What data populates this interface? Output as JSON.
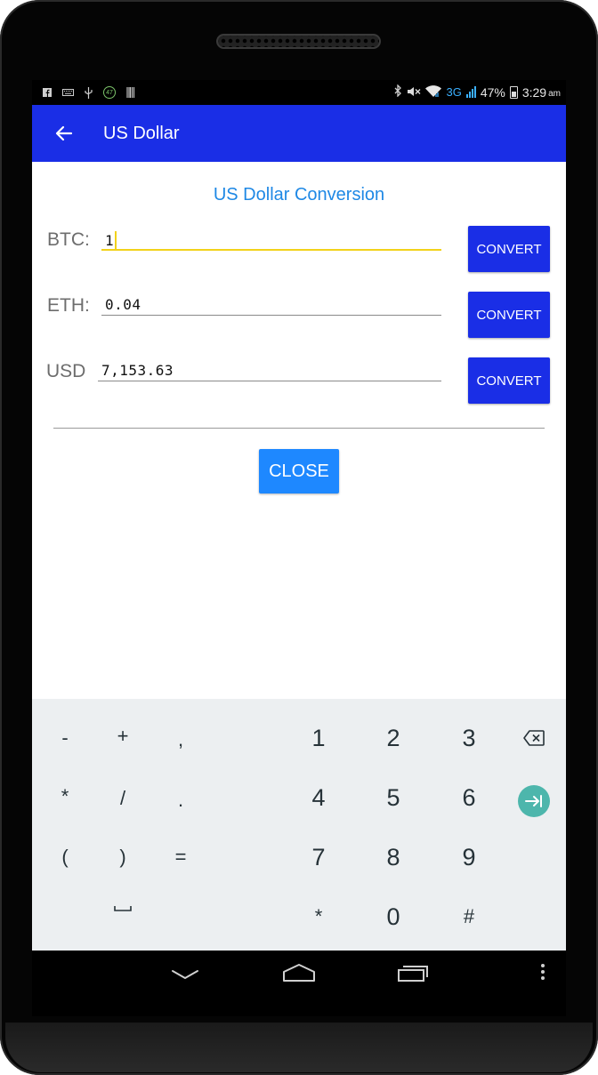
{
  "status_bar": {
    "left_icons": [
      "facebook-icon",
      "keyboard-icon",
      "usb-icon",
      "notification-badge-icon",
      "barcode-icon"
    ],
    "badge_text": "47",
    "network": "3G",
    "battery": "47%",
    "time": "3:29",
    "ampm": "am"
  },
  "app_bar": {
    "title": "US Dollar"
  },
  "conversion": {
    "title": "US Dollar Conversion",
    "rows": [
      {
        "label": "BTC:",
        "value": "1",
        "button": "CONVERT"
      },
      {
        "label": "ETH:",
        "value": "0.04",
        "button": "CONVERT"
      },
      {
        "label": "USD",
        "value": "7,153.63",
        "button": "CONVERT"
      }
    ],
    "close_label": "CLOSE"
  },
  "keyboard": {
    "symbols": [
      [
        "-",
        "+",
        ","
      ],
      [
        "*",
        "/",
        "."
      ],
      [
        "(",
        ")",
        "="
      ],
      [
        "",
        "␣",
        ""
      ]
    ],
    "numbers": [
      [
        "1",
        "2",
        "3"
      ],
      [
        "4",
        "5",
        "6"
      ],
      [
        "7",
        "8",
        "9"
      ],
      [
        "*",
        "0",
        "#"
      ]
    ],
    "backspace_icon": "backspace-icon",
    "next_icon": "tab-next-icon"
  },
  "colors": {
    "app_bar": "#1a2ee6",
    "accent_title": "#1e88e5",
    "focus_underline": "#f2d21a",
    "close_button": "#1e88ff",
    "keyboard_bg": "#eceff1",
    "enter_key": "#4db6ac"
  }
}
